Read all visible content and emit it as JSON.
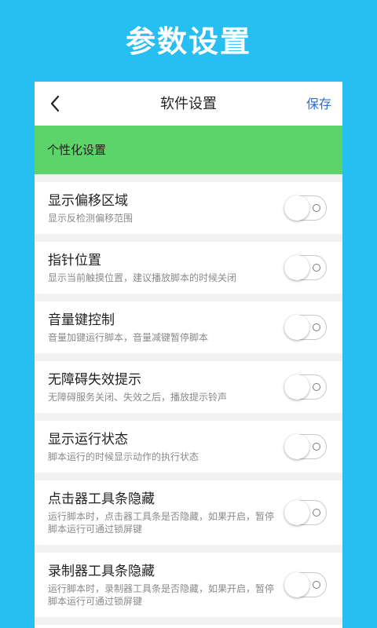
{
  "hero": {
    "title": "参数设置"
  },
  "topbar": {
    "title": "软件设置",
    "save_label": "保存",
    "back_icon": "chevron-left-icon"
  },
  "section": {
    "title": "个性化设置",
    "color": "#5cd46a"
  },
  "settings": [
    {
      "title": "显示偏移区域",
      "desc": "显示反检测偏移范围",
      "enabled": false
    },
    {
      "title": "指针位置",
      "desc": "显示当前触摸位置，建议播放脚本的时候关闭",
      "enabled": false
    },
    {
      "title": "音量键控制",
      "desc": "音量加键运行脚本，音量减键暂停脚本",
      "enabled": false
    },
    {
      "title": "无障碍失效提示",
      "desc": "无障碍服务关闭、失效之后，播放提示铃声",
      "enabled": false
    },
    {
      "title": "显示运行状态",
      "desc": "脚本运行的时候显示动作的执行状态",
      "enabled": false
    },
    {
      "title": "点击器工具条隐藏",
      "desc": "运行脚本时，点击器工具条是否隐藏，如果开启，暂停脚本运行可通过锁屏键",
      "enabled": false
    },
    {
      "title": "录制器工具条隐藏",
      "desc": "运行脚本时，录制器工具条是否隐藏，如果开启，暂停脚本运行可通过锁屏键",
      "enabled": false
    }
  ],
  "colors": {
    "background": "#27bff2",
    "accent": "#2b6fd6"
  }
}
